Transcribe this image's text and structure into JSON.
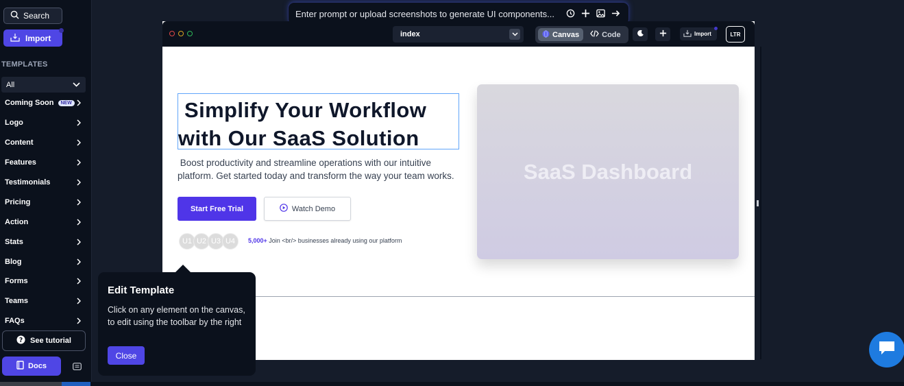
{
  "sidebar": {
    "search_label": "Search",
    "import_label": "Import",
    "templates_heading": "TEMPLATES",
    "filter_value": "All",
    "categories": [
      {
        "label": "Coming Soon",
        "badge": "NEW"
      },
      {
        "label": "Logo"
      },
      {
        "label": "Content"
      },
      {
        "label": "Features"
      },
      {
        "label": "Testimonials"
      },
      {
        "label": "Pricing"
      },
      {
        "label": "Action"
      },
      {
        "label": "Stats"
      },
      {
        "label": "Blog"
      },
      {
        "label": "Forms"
      },
      {
        "label": "Teams"
      },
      {
        "label": "FAQs"
      }
    ],
    "tutorial_label": "See tutorial",
    "docs_label": "Docs"
  },
  "prompt": {
    "placeholder": "Enter prompt or upload screenshots to generate UI components..."
  },
  "toolbar": {
    "page_value": "index",
    "canvas_label": "Canvas",
    "code_label": "Code",
    "import_label": "Import",
    "direction_label": "LTR"
  },
  "hero": {
    "title_line1": "Simplify Your Workflow",
    "title_line2": "with Our SaaS Solution",
    "subtitle": " Boost productivity and streamline operations with our intuitive platform. Get started today and transform the way your team works.",
    "primary_cta": "Start Free Trial",
    "secondary_cta": "Watch Demo",
    "avatars": [
      "U1",
      "U2",
      "U3",
      "U4"
    ],
    "proof_count": "5,000+",
    "proof_text": " Join <br/> businesses already using our platform",
    "image_placeholder": "SaaS Dashboard"
  },
  "tour": {
    "title": "Edit Template",
    "body": "Click on any element on the canvas, to edit using the toolbar by the right",
    "close_label": "Close"
  },
  "colors": {
    "accent": "#4f46e5",
    "primary_button": "#4f35e8",
    "background": "#151c2a",
    "panel": "#0b111c",
    "chat_fab": "#1e7be0"
  }
}
